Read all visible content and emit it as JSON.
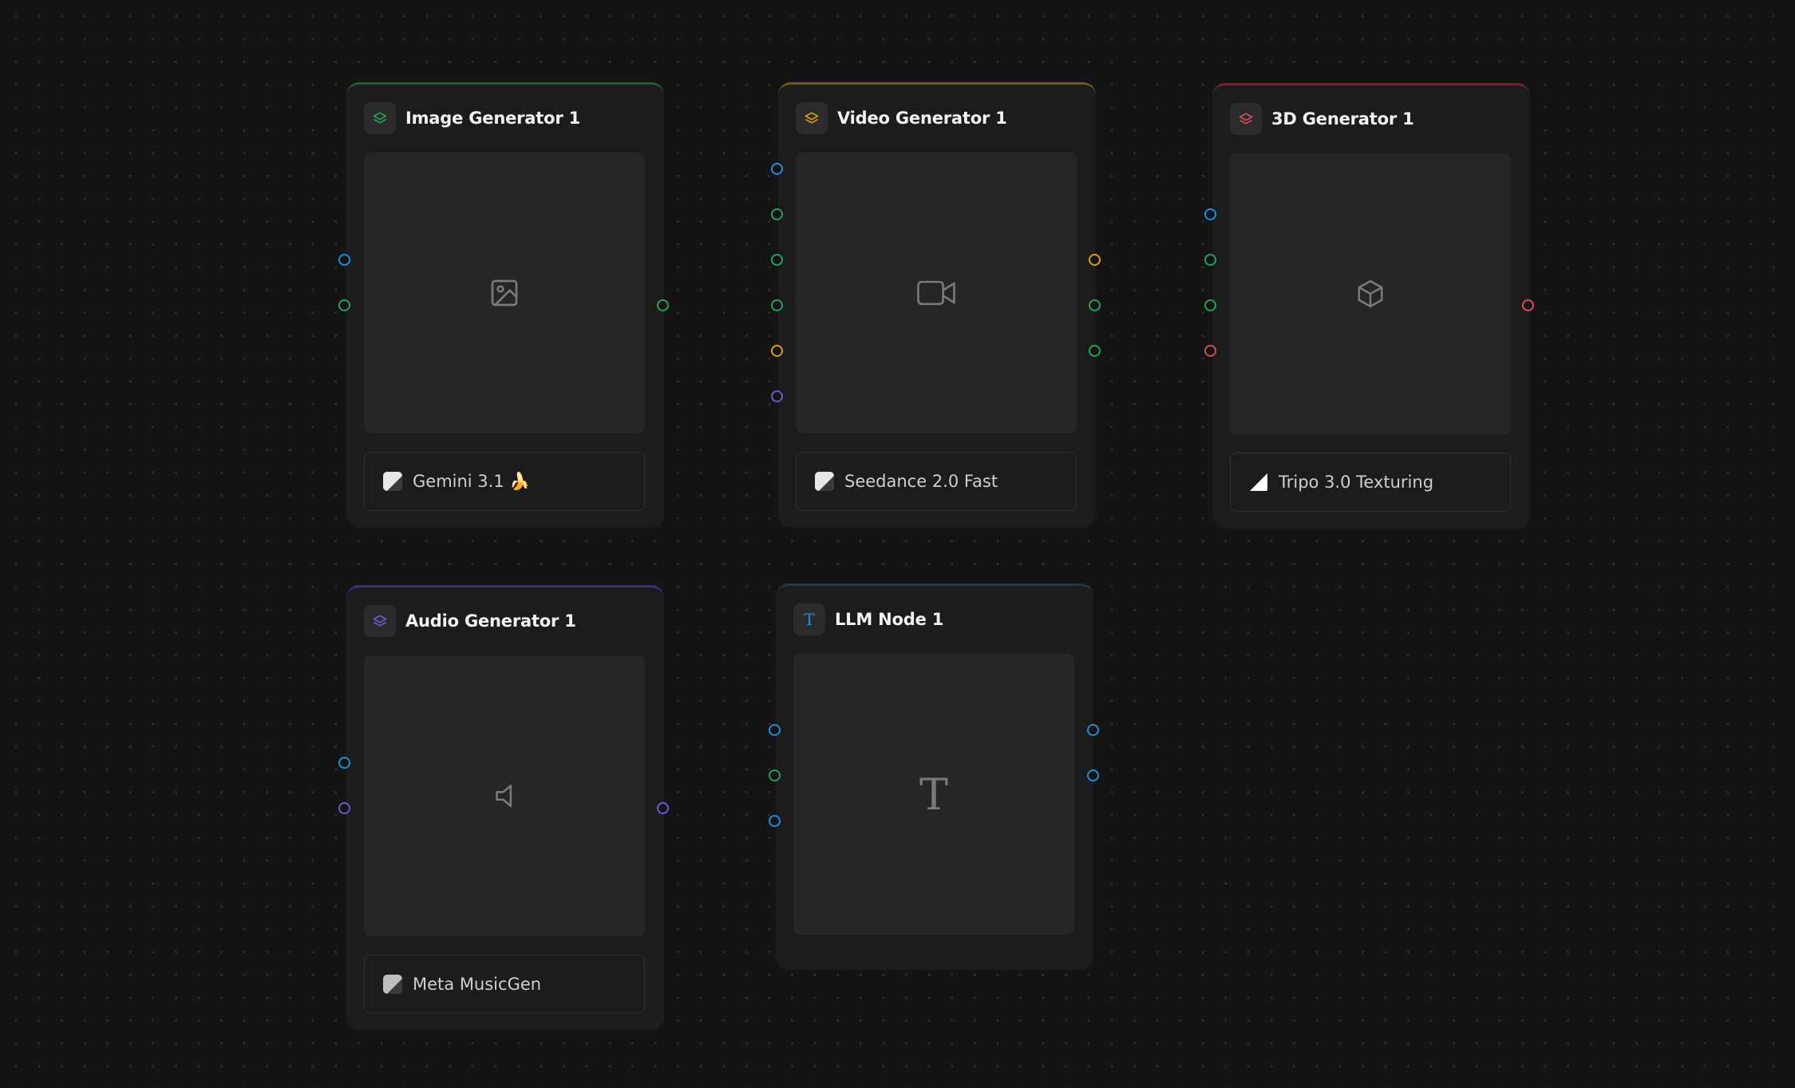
{
  "colors": {
    "blue": "#1e8fd6",
    "green": "#23a35a",
    "yellow": "#d4a017",
    "purple": "#6a5ad7",
    "red": "#d94b5a"
  },
  "nodes": {
    "image": {
      "title": "Image Generator 1",
      "icon": "layers-icon",
      "accent": "#23a35a",
      "preview_icon": "image-icon",
      "model": "Gemini 3.1 🍌",
      "input_ports": [
        "blue",
        "green"
      ],
      "output_ports": [
        "green"
      ]
    },
    "video": {
      "title": "Video Generator 1",
      "icon": "layers-icon",
      "accent": "#d4a017",
      "preview_icon": "video-camera-icon",
      "model": "Seedance 2.0 Fast",
      "input_ports": [
        "blue",
        "green",
        "green",
        "green",
        "yellow",
        "purple"
      ],
      "output_ports": [
        "yellow",
        "green",
        "green"
      ]
    },
    "threed": {
      "title": "3D Generator 1",
      "icon": "layers-icon",
      "accent": "#d94b5a",
      "preview_icon": "cube-icon",
      "model": "Tripo 3.0 Texturing",
      "input_ports": [
        "blue",
        "green",
        "green",
        "red"
      ],
      "output_ports": [
        "red"
      ]
    },
    "audio": {
      "title": "Audio Generator 1",
      "icon": "layers-icon",
      "accent": "#6a5ad7",
      "preview_icon": "speaker-icon",
      "model": "Meta MusicGen",
      "input_ports": [
        "blue",
        "purple"
      ],
      "output_ports": [
        "purple"
      ]
    },
    "llm": {
      "title": "LLM Node 1",
      "icon": "text-icon",
      "accent": "#1e6fa6",
      "preview_icon": "text-icon",
      "preview_glyph": "T",
      "header_glyph": "T",
      "input_ports": [
        "blue",
        "green",
        "blue"
      ],
      "output_ports": [
        "blue",
        "blue"
      ]
    }
  }
}
